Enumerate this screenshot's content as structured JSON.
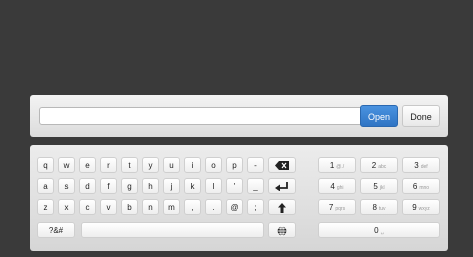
{
  "input": {
    "open_label": "Open",
    "done_label": "Done"
  },
  "keyboard": {
    "row1": [
      "q",
      "w",
      "e",
      "r",
      "t",
      "y",
      "u",
      "i",
      "o",
      "p",
      "-"
    ],
    "row2": [
      "a",
      "s",
      "d",
      "f",
      "g",
      "h",
      "j",
      "k",
      "l",
      "'",
      "_"
    ],
    "row3": [
      "z",
      "x",
      "c",
      "v",
      "b",
      "n",
      "m",
      ",",
      ".",
      "@",
      ";"
    ],
    "symbols_label": "?&#",
    "numpad": [
      {
        "digit": "1",
        "letters": "@./"
      },
      {
        "digit": "2",
        "letters": "abc"
      },
      {
        "digit": "3",
        "letters": "def"
      },
      {
        "digit": "4",
        "letters": "ghi"
      },
      {
        "digit": "5",
        "letters": "jkl"
      },
      {
        "digit": "6",
        "letters": "mno"
      },
      {
        "digit": "7",
        "letters": "pqrs"
      },
      {
        "digit": "8",
        "letters": "tuv"
      },
      {
        "digit": "9",
        "letters": "wxyz"
      },
      {
        "digit": "0",
        "letters": "␣"
      }
    ],
    "icons": {
      "backspace": "backspace-icon",
      "enter": "enter-icon",
      "shift": "shift-up-icon",
      "globe": "globe-icon"
    }
  }
}
